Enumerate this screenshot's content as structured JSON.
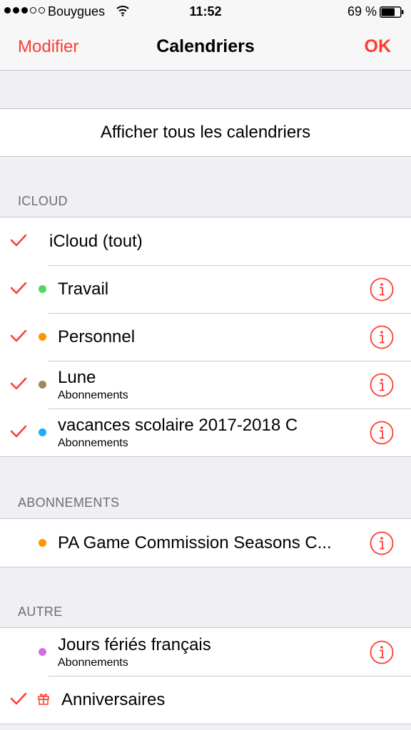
{
  "status_bar": {
    "carrier": "Bouygues",
    "time": "11:52",
    "battery": "69 %",
    "icons": [
      "signal-dots-icon",
      "wifi-icon",
      "battery-icon"
    ]
  },
  "nav": {
    "left": "Modifier",
    "title": "Calendriers",
    "right": "OK"
  },
  "show_all": "Afficher tous les calendriers",
  "sections": [
    {
      "header": "ICLOUD",
      "items": [
        {
          "label": "iCloud (tout)",
          "checked": true
        },
        {
          "label": "Travail",
          "color": "#4cd964",
          "checked": true
        },
        {
          "label": "Personnel",
          "color": "#ff9500",
          "checked": true
        },
        {
          "label": "Lune",
          "subtitle": "Abonnements",
          "color": "#a2845e",
          "checked": true
        },
        {
          "label": "vacances scolaire  2017-2018 C",
          "subtitle": "Abonnements",
          "color": "#1badf8",
          "checked": true
        }
      ]
    },
    {
      "header": "ABONNEMENTS",
      "items": [
        {
          "label": "PA Game Commission Seasons C...",
          "color": "#ff9500",
          "checked": false
        }
      ]
    },
    {
      "header": "AUTRE",
      "items": [
        {
          "label": "Jours fériés français",
          "subtitle": "Abonnements",
          "color": "#cc73e1",
          "checked": false
        },
        {
          "label": "Anniversaires",
          "icon": "gift-icon",
          "checked": true
        }
      ]
    }
  ],
  "colors": {
    "accent": "#ff3b30",
    "background": "#efeff4"
  }
}
